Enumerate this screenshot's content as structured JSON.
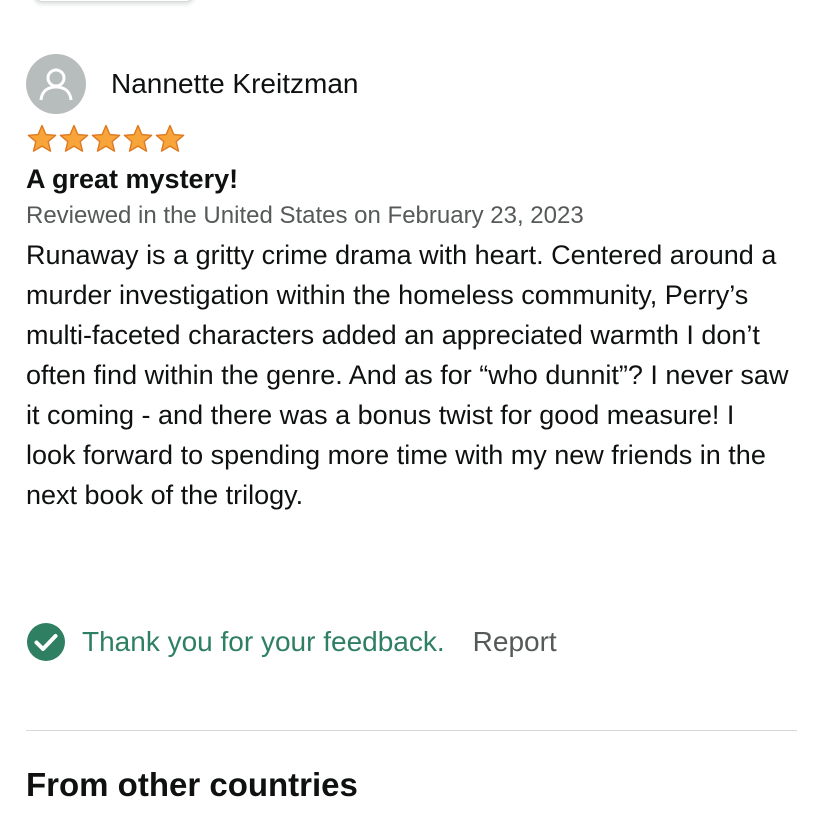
{
  "review": {
    "profile_name": "Nannette Kreitzman",
    "avatar_icon": "person-icon",
    "rating": 5,
    "rating_max": 5,
    "star_color": "#f7a43b",
    "title": "A great mystery!",
    "date_line": "Reviewed in the United States on February 23, 2023",
    "body": "Runaway is a gritty crime drama with heart. Centered around a murder investigation within the homeless community, Perry’s multi-faceted characters added an appreciated warmth I don’t often find within the genre. And as for “who dunnit”? I never saw it coming - and there was a bonus twist for good measure! I look forward to spending more time with my new friends in the next book of the trilogy."
  },
  "feedback": {
    "check_icon": "checkmark-circle-icon",
    "check_color": "#2f7f63",
    "thank_you_text": "Thank you for your feedback.",
    "report_label": "Report"
  },
  "other_countries": {
    "heading": "From other countries"
  }
}
